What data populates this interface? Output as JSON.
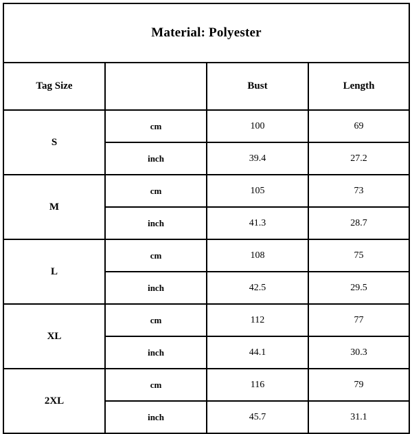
{
  "title": "Material: Polyester",
  "headers": {
    "tag_size": "Tag Size",
    "unit": "",
    "bust": "Bust",
    "length": "Length"
  },
  "units": {
    "metric": "cm",
    "imperial": "inch"
  },
  "colors": {
    "shaded_row_background": "#c0c0c0",
    "border": "#000000",
    "page_background": "#ffffff"
  },
  "chart_data": {
    "type": "table",
    "title": "Material: Polyester",
    "columns": [
      "Tag Size",
      "",
      "Bust",
      "Length"
    ],
    "rows": [
      {
        "size": "S",
        "unit": "cm",
        "bust": "100",
        "length": "69",
        "shaded": false
      },
      {
        "size": "S",
        "unit": "inch",
        "bust": "39.4",
        "length": "27.2",
        "shaded": true
      },
      {
        "size": "M",
        "unit": "cm",
        "bust": "105",
        "length": "73",
        "shaded": false
      },
      {
        "size": "M",
        "unit": "inch",
        "bust": "41.3",
        "length": "28.7",
        "shaded": true
      },
      {
        "size": "L",
        "unit": "cm",
        "bust": "108",
        "length": "75",
        "shaded": false
      },
      {
        "size": "L",
        "unit": "inch",
        "bust": "42.5",
        "length": "29.5",
        "shaded": true
      },
      {
        "size": "XL",
        "unit": "cm",
        "bust": "112",
        "length": "77",
        "shaded": false
      },
      {
        "size": "XL",
        "unit": "inch",
        "bust": "44.1",
        "length": "30.3",
        "shaded": true
      },
      {
        "size": "2XL",
        "unit": "cm",
        "bust": "116",
        "length": "79",
        "shaded": false
      },
      {
        "size": "2XL",
        "unit": "inch",
        "bust": "45.7",
        "length": "31.1",
        "shaded": true
      }
    ]
  },
  "sizes": [
    {
      "label": "S",
      "metric": {
        "unit": "cm",
        "bust": "100",
        "length": "69"
      },
      "imperial": {
        "unit": "inch",
        "bust": "39.4",
        "length": "27.2"
      }
    },
    {
      "label": "M",
      "metric": {
        "unit": "cm",
        "bust": "105",
        "length": "73"
      },
      "imperial": {
        "unit": "inch",
        "bust": "41.3",
        "length": "28.7"
      }
    },
    {
      "label": "L",
      "metric": {
        "unit": "cm",
        "bust": "108",
        "length": "75"
      },
      "imperial": {
        "unit": "inch",
        "bust": "42.5",
        "length": "29.5"
      }
    },
    {
      "label": "XL",
      "metric": {
        "unit": "cm",
        "bust": "112",
        "length": "77"
      },
      "imperial": {
        "unit": "inch",
        "bust": "44.1",
        "length": "30.3"
      }
    },
    {
      "label": "2XL",
      "metric": {
        "unit": "cm",
        "bust": "116",
        "length": "79"
      },
      "imperial": {
        "unit": "inch",
        "bust": "45.7",
        "length": "31.1"
      }
    }
  ]
}
